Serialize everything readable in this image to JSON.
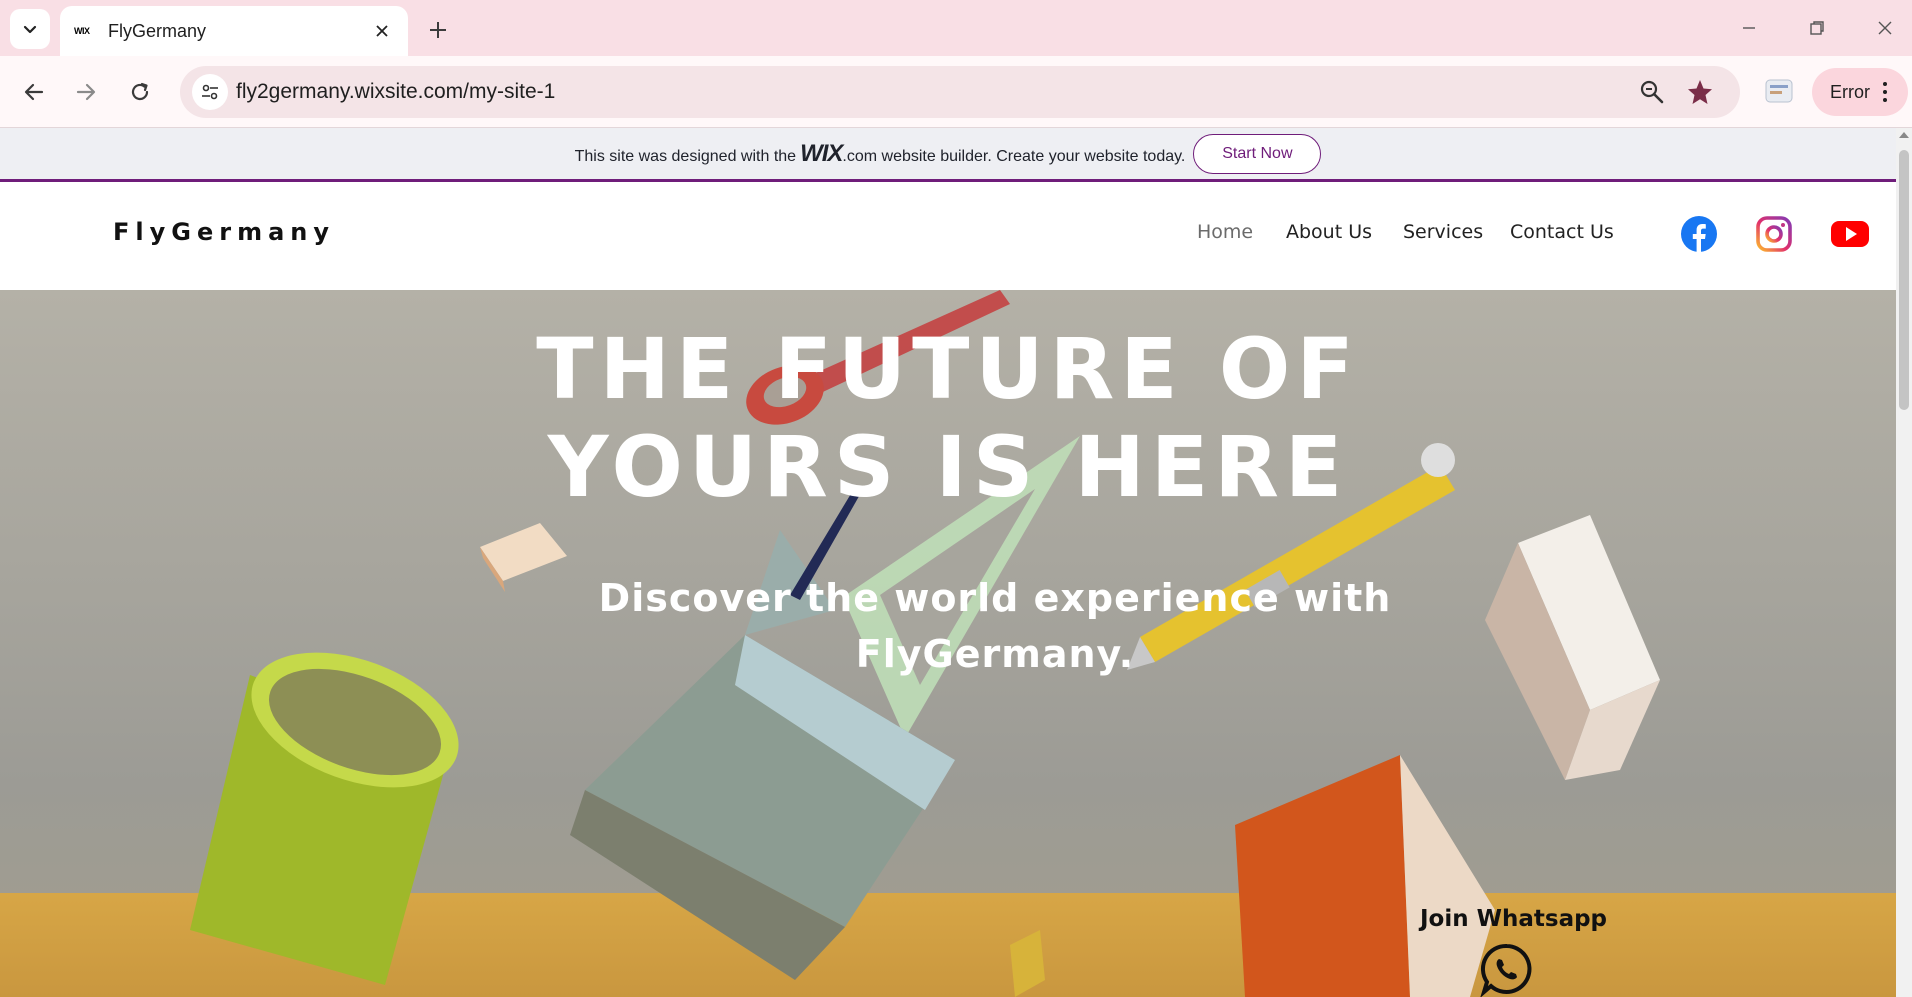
{
  "browser": {
    "tab_title": "FlyGermany",
    "tab_favicon": "WIX",
    "url": "fly2germany.wixsite.com/my-site-1",
    "profile_label": "Error"
  },
  "wix_banner": {
    "text_before": "This site was designed with the",
    "logo": "WIX",
    "text_after": ".com website builder. Create your website today.",
    "button": "Start Now"
  },
  "site": {
    "logo": "FlyGermany",
    "nav": [
      "Home",
      "About Us",
      "Services",
      "Contact Us"
    ],
    "social": [
      "facebook-icon",
      "instagram-icon",
      "youtube-icon"
    ]
  },
  "hero": {
    "title_line1": "THE FUTURE OF",
    "title_line2": "YOURS IS HERE",
    "subtitle_line1": "Discover the world experience with",
    "subtitle_line2": "FlyGermany.",
    "whatsapp_label": "Join Whatsapp"
  },
  "colors": {
    "wix_accent": "#6f1d7a",
    "tabstrip": "#f9dfe5",
    "facebook": "#1877f2",
    "youtube": "#ff0000"
  }
}
